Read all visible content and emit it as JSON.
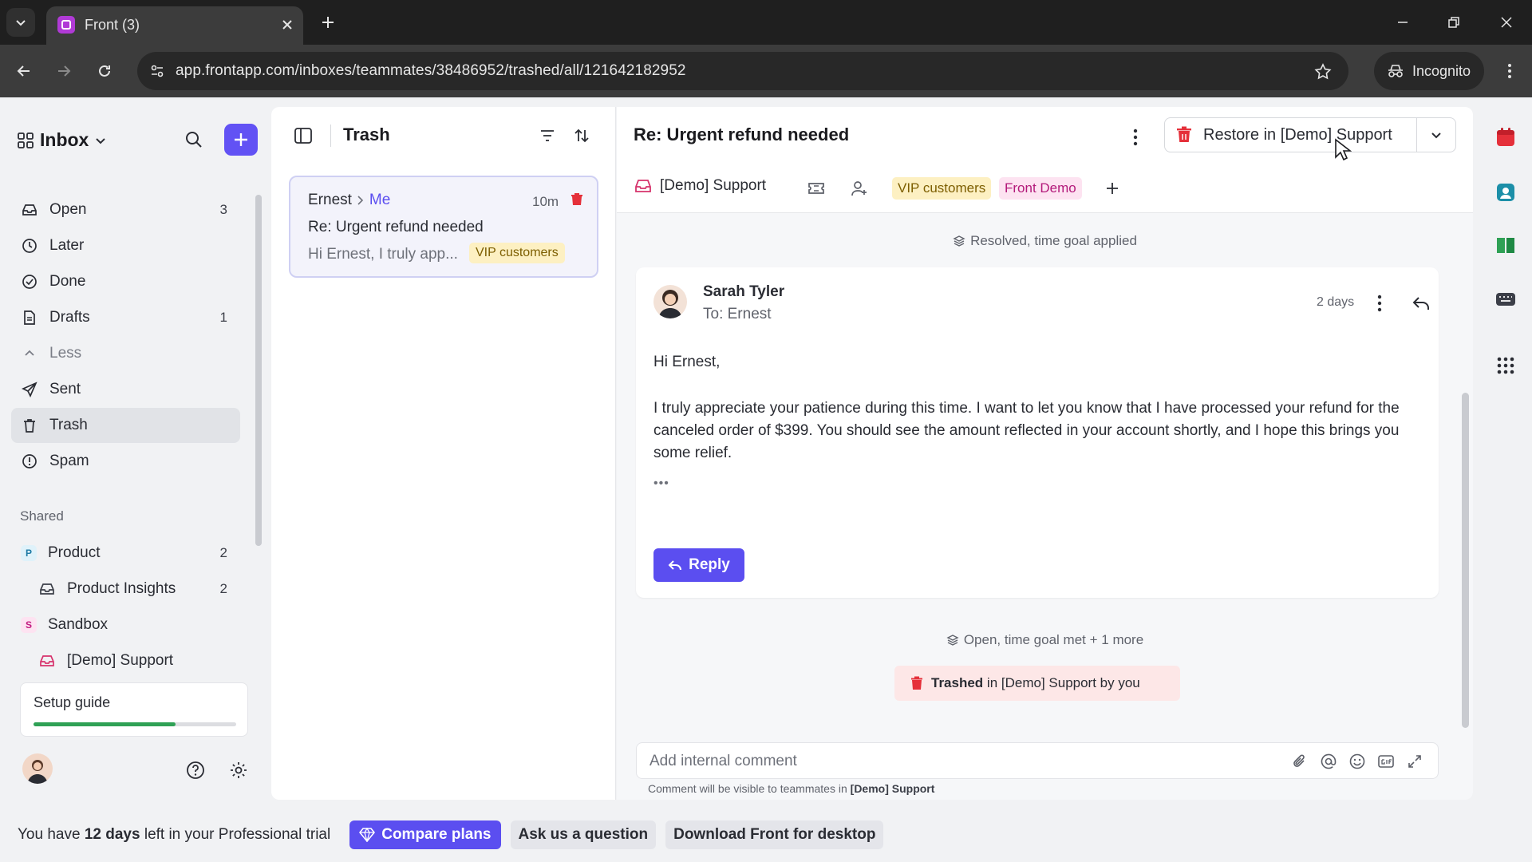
{
  "browser": {
    "tab_title": "Front (3)",
    "url": "app.frontapp.com/inboxes/teammates/38486952/trashed/all/121642182952",
    "incognito_label": "Incognito"
  },
  "sidebar": {
    "title": "Inbox",
    "items": [
      {
        "label": "Open",
        "count": "3",
        "icon": "inbox-icon"
      },
      {
        "label": "Later",
        "count": "",
        "icon": "clock-icon"
      },
      {
        "label": "Done",
        "count": "",
        "icon": "check-circle-icon"
      },
      {
        "label": "Drafts",
        "count": "1",
        "icon": "draft-icon"
      },
      {
        "label": "Less",
        "count": "",
        "icon": "chevron-up-icon"
      },
      {
        "label": "Sent",
        "count": "",
        "icon": "send-icon"
      },
      {
        "label": "Trash",
        "count": "",
        "icon": "trash-icon"
      },
      {
        "label": "Spam",
        "count": "",
        "icon": "spam-icon"
      }
    ],
    "shared_heading": "Shared",
    "shared": [
      {
        "badge": "P",
        "label": "Product",
        "count": "2"
      },
      {
        "label": "Product Insights",
        "count": "2"
      },
      {
        "badge": "S",
        "label": "Sandbox",
        "count": ""
      },
      {
        "label": "[Demo] Support",
        "count": ""
      }
    ],
    "setup_guide": {
      "label": "Setup guide",
      "progress": 0.7
    }
  },
  "list": {
    "title": "Trash",
    "conversation": {
      "from": "Ernest",
      "to": "Me",
      "time": "10m",
      "subject": "Re: Urgent refund needed",
      "preview": "Hi Ernest, I truly app...",
      "tag": "VIP customers"
    }
  },
  "conversation": {
    "title": "Re: Urgent refund needed",
    "restore_label": "Restore in [Demo] Support",
    "inbox": "[Demo] Support",
    "tags": [
      "VIP customers",
      "Front Demo"
    ],
    "status_resolved": "Resolved, time goal applied",
    "message": {
      "sender": "Sarah Tyler",
      "to": "To: Ernest",
      "time": "2 days",
      "greeting": "Hi Ernest,",
      "body": "I truly appreciate your patience during this time. I want to let you know that I have processed your refund for the canceled order of $399. You should see the amount reflected in your account shortly, and I hope this brings you some relief.",
      "ellipsis": "•••",
      "reply_label": "Reply"
    },
    "status_open": "Open, time goal met + 1 more",
    "trashed_notice": {
      "bold": "Trashed",
      "rest": " in [Demo] Support by you"
    },
    "comment": {
      "placeholder": "Add internal comment",
      "hint_prefix": "Comment will be visible to teammates in ",
      "hint_inbox": "[Demo] Support"
    }
  },
  "banner": {
    "prefix": "You have ",
    "days": "12 days",
    "suffix": " left in your Professional trial",
    "compare_label": "Compare plans",
    "ask_label": "Ask us a question",
    "download_label": "Download Front for desktop"
  },
  "colors": {
    "accent": "#5b4ef0",
    "compose": "#6252f4",
    "trash_red": "#e5303a",
    "vip_tag_bg": "#fdf0c2",
    "front_demo_tag_bg": "#fde3f1"
  }
}
